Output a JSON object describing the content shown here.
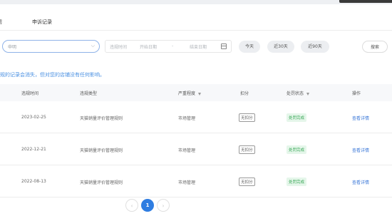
{
  "tabs": [
    "罚",
    "申诉记录"
  ],
  "filters": {
    "type_select": "申明",
    "date_label": "违规时间",
    "start_placeholder": "开始日期",
    "separator": "-",
    "end_placeholder": "结束日期",
    "quick": [
      "今天",
      "近30天",
      "近90天"
    ],
    "search_label": "搜索"
  },
  "notice": "规的记录会消失，但对您的店铺没有任何影响。",
  "table": {
    "headers": [
      "违规时间",
      "违规类型",
      "严重程度",
      "扣分",
      "处罚状态",
      "操作"
    ],
    "rows": [
      {
        "date": "2023-02-25",
        "type": "天猫销量评价管理规则",
        "severity": "市场管理",
        "deduct": "无扣分",
        "status": "处罚完成",
        "action": "查看详情"
      },
      {
        "date": "2022-12-21",
        "type": "天猫销量评价管理规则",
        "severity": "市场管理",
        "deduct": "无扣分",
        "status": "处罚完成",
        "action": "查看详情"
      },
      {
        "date": "2022-08-13",
        "type": "天猫销量评价管理规则",
        "severity": "市场管理",
        "deduct": "无扣分",
        "status": "处罚完成",
        "action": "查看详情"
      }
    ]
  },
  "pagination": {
    "prev": "‹",
    "current": "1",
    "next": "›"
  },
  "colors": {
    "primary": "#2f7de1",
    "success": "#3aa757",
    "link": "#3b78d8"
  }
}
